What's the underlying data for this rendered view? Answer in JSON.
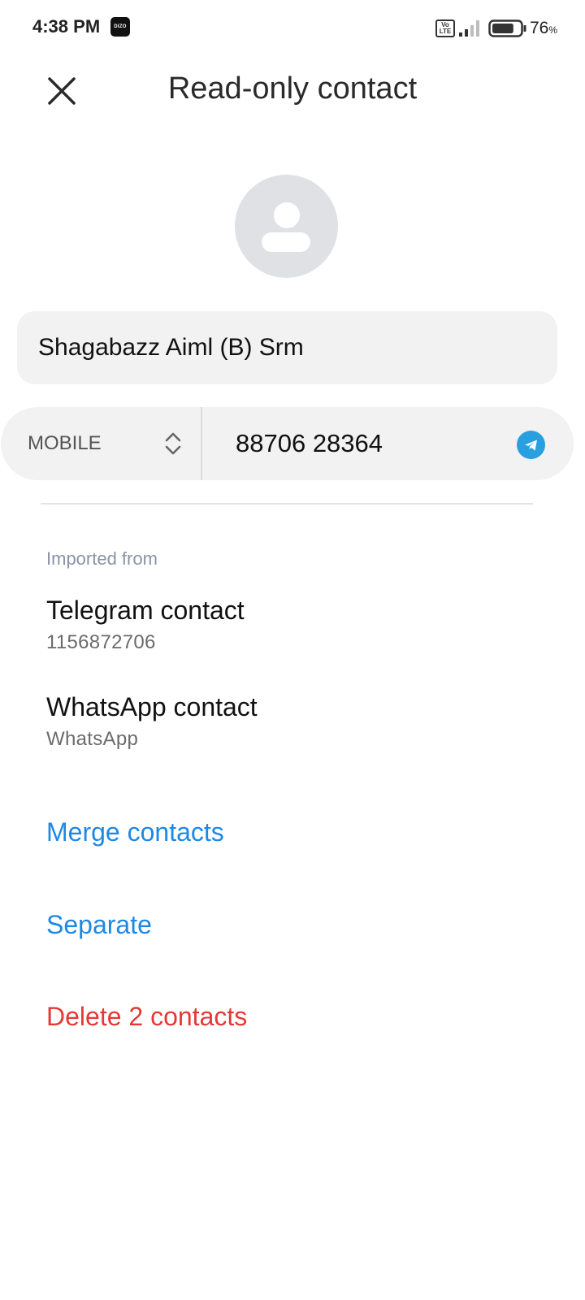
{
  "status_bar": {
    "time": "4:38 PM",
    "notification_badge": "DIZO",
    "volte_top": "Vo",
    "volte_bottom": "LTE",
    "battery_level": "76",
    "battery_unit": "%",
    "battery_fraction": 0.76
  },
  "header": {
    "title": "Read-only contact",
    "close_icon": "close-icon"
  },
  "contact": {
    "name": "Shagabazz Aiml (B) Srm",
    "phone": {
      "type": "MOBILE",
      "number": "88706 28364"
    }
  },
  "imported": {
    "label": "Imported from",
    "sources": [
      {
        "title": "Telegram contact",
        "subtitle": "1156872706"
      },
      {
        "title": "WhatsApp contact",
        "subtitle": "WhatsApp"
      }
    ]
  },
  "actions": {
    "merge": "Merge contacts",
    "separate": "Separate",
    "delete": "Delete 2 contacts"
  },
  "colors": {
    "link_blue": "#1e88e5",
    "danger_red": "#e53935",
    "telegram_blue": "#2a9fe0",
    "field_bg": "#f2f2f2"
  }
}
